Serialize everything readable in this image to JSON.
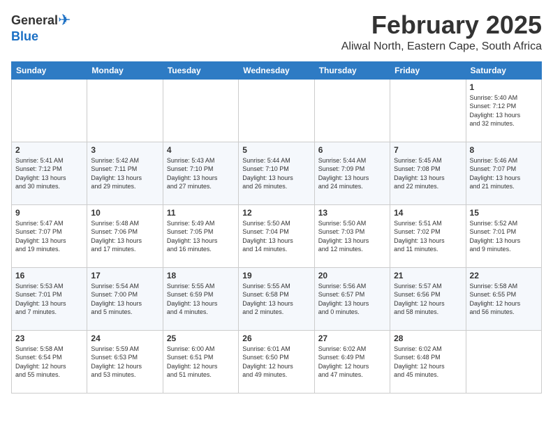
{
  "logo": {
    "general": "General",
    "blue": "Blue"
  },
  "header": {
    "month_year": "February 2025",
    "location": "Aliwal North, Eastern Cape, South Africa"
  },
  "days_of_week": [
    "Sunday",
    "Monday",
    "Tuesday",
    "Wednesday",
    "Thursday",
    "Friday",
    "Saturday"
  ],
  "weeks": [
    [
      {
        "day": "",
        "info": ""
      },
      {
        "day": "",
        "info": ""
      },
      {
        "day": "",
        "info": ""
      },
      {
        "day": "",
        "info": ""
      },
      {
        "day": "",
        "info": ""
      },
      {
        "day": "",
        "info": ""
      },
      {
        "day": "1",
        "info": "Sunrise: 5:40 AM\nSunset: 7:12 PM\nDaylight: 13 hours\nand 32 minutes."
      }
    ],
    [
      {
        "day": "2",
        "info": "Sunrise: 5:41 AM\nSunset: 7:12 PM\nDaylight: 13 hours\nand 30 minutes."
      },
      {
        "day": "3",
        "info": "Sunrise: 5:42 AM\nSunset: 7:11 PM\nDaylight: 13 hours\nand 29 minutes."
      },
      {
        "day": "4",
        "info": "Sunrise: 5:43 AM\nSunset: 7:10 PM\nDaylight: 13 hours\nand 27 minutes."
      },
      {
        "day": "5",
        "info": "Sunrise: 5:44 AM\nSunset: 7:10 PM\nDaylight: 13 hours\nand 26 minutes."
      },
      {
        "day": "6",
        "info": "Sunrise: 5:44 AM\nSunset: 7:09 PM\nDaylight: 13 hours\nand 24 minutes."
      },
      {
        "day": "7",
        "info": "Sunrise: 5:45 AM\nSunset: 7:08 PM\nDaylight: 13 hours\nand 22 minutes."
      },
      {
        "day": "8",
        "info": "Sunrise: 5:46 AM\nSunset: 7:07 PM\nDaylight: 13 hours\nand 21 minutes."
      }
    ],
    [
      {
        "day": "9",
        "info": "Sunrise: 5:47 AM\nSunset: 7:07 PM\nDaylight: 13 hours\nand 19 minutes."
      },
      {
        "day": "10",
        "info": "Sunrise: 5:48 AM\nSunset: 7:06 PM\nDaylight: 13 hours\nand 17 minutes."
      },
      {
        "day": "11",
        "info": "Sunrise: 5:49 AM\nSunset: 7:05 PM\nDaylight: 13 hours\nand 16 minutes."
      },
      {
        "day": "12",
        "info": "Sunrise: 5:50 AM\nSunset: 7:04 PM\nDaylight: 13 hours\nand 14 minutes."
      },
      {
        "day": "13",
        "info": "Sunrise: 5:50 AM\nSunset: 7:03 PM\nDaylight: 13 hours\nand 12 minutes."
      },
      {
        "day": "14",
        "info": "Sunrise: 5:51 AM\nSunset: 7:02 PM\nDaylight: 13 hours\nand 11 minutes."
      },
      {
        "day": "15",
        "info": "Sunrise: 5:52 AM\nSunset: 7:01 PM\nDaylight: 13 hours\nand 9 minutes."
      }
    ],
    [
      {
        "day": "16",
        "info": "Sunrise: 5:53 AM\nSunset: 7:01 PM\nDaylight: 13 hours\nand 7 minutes."
      },
      {
        "day": "17",
        "info": "Sunrise: 5:54 AM\nSunset: 7:00 PM\nDaylight: 13 hours\nand 5 minutes."
      },
      {
        "day": "18",
        "info": "Sunrise: 5:55 AM\nSunset: 6:59 PM\nDaylight: 13 hours\nand 4 minutes."
      },
      {
        "day": "19",
        "info": "Sunrise: 5:55 AM\nSunset: 6:58 PM\nDaylight: 13 hours\nand 2 minutes."
      },
      {
        "day": "20",
        "info": "Sunrise: 5:56 AM\nSunset: 6:57 PM\nDaylight: 13 hours\nand 0 minutes."
      },
      {
        "day": "21",
        "info": "Sunrise: 5:57 AM\nSunset: 6:56 PM\nDaylight: 12 hours\nand 58 minutes."
      },
      {
        "day": "22",
        "info": "Sunrise: 5:58 AM\nSunset: 6:55 PM\nDaylight: 12 hours\nand 56 minutes."
      }
    ],
    [
      {
        "day": "23",
        "info": "Sunrise: 5:58 AM\nSunset: 6:54 PM\nDaylight: 12 hours\nand 55 minutes."
      },
      {
        "day": "24",
        "info": "Sunrise: 5:59 AM\nSunset: 6:53 PM\nDaylight: 12 hours\nand 53 minutes."
      },
      {
        "day": "25",
        "info": "Sunrise: 6:00 AM\nSunset: 6:51 PM\nDaylight: 12 hours\nand 51 minutes."
      },
      {
        "day": "26",
        "info": "Sunrise: 6:01 AM\nSunset: 6:50 PM\nDaylight: 12 hours\nand 49 minutes."
      },
      {
        "day": "27",
        "info": "Sunrise: 6:02 AM\nSunset: 6:49 PM\nDaylight: 12 hours\nand 47 minutes."
      },
      {
        "day": "28",
        "info": "Sunrise: 6:02 AM\nSunset: 6:48 PM\nDaylight: 12 hours\nand 45 minutes."
      },
      {
        "day": "",
        "info": ""
      }
    ]
  ]
}
